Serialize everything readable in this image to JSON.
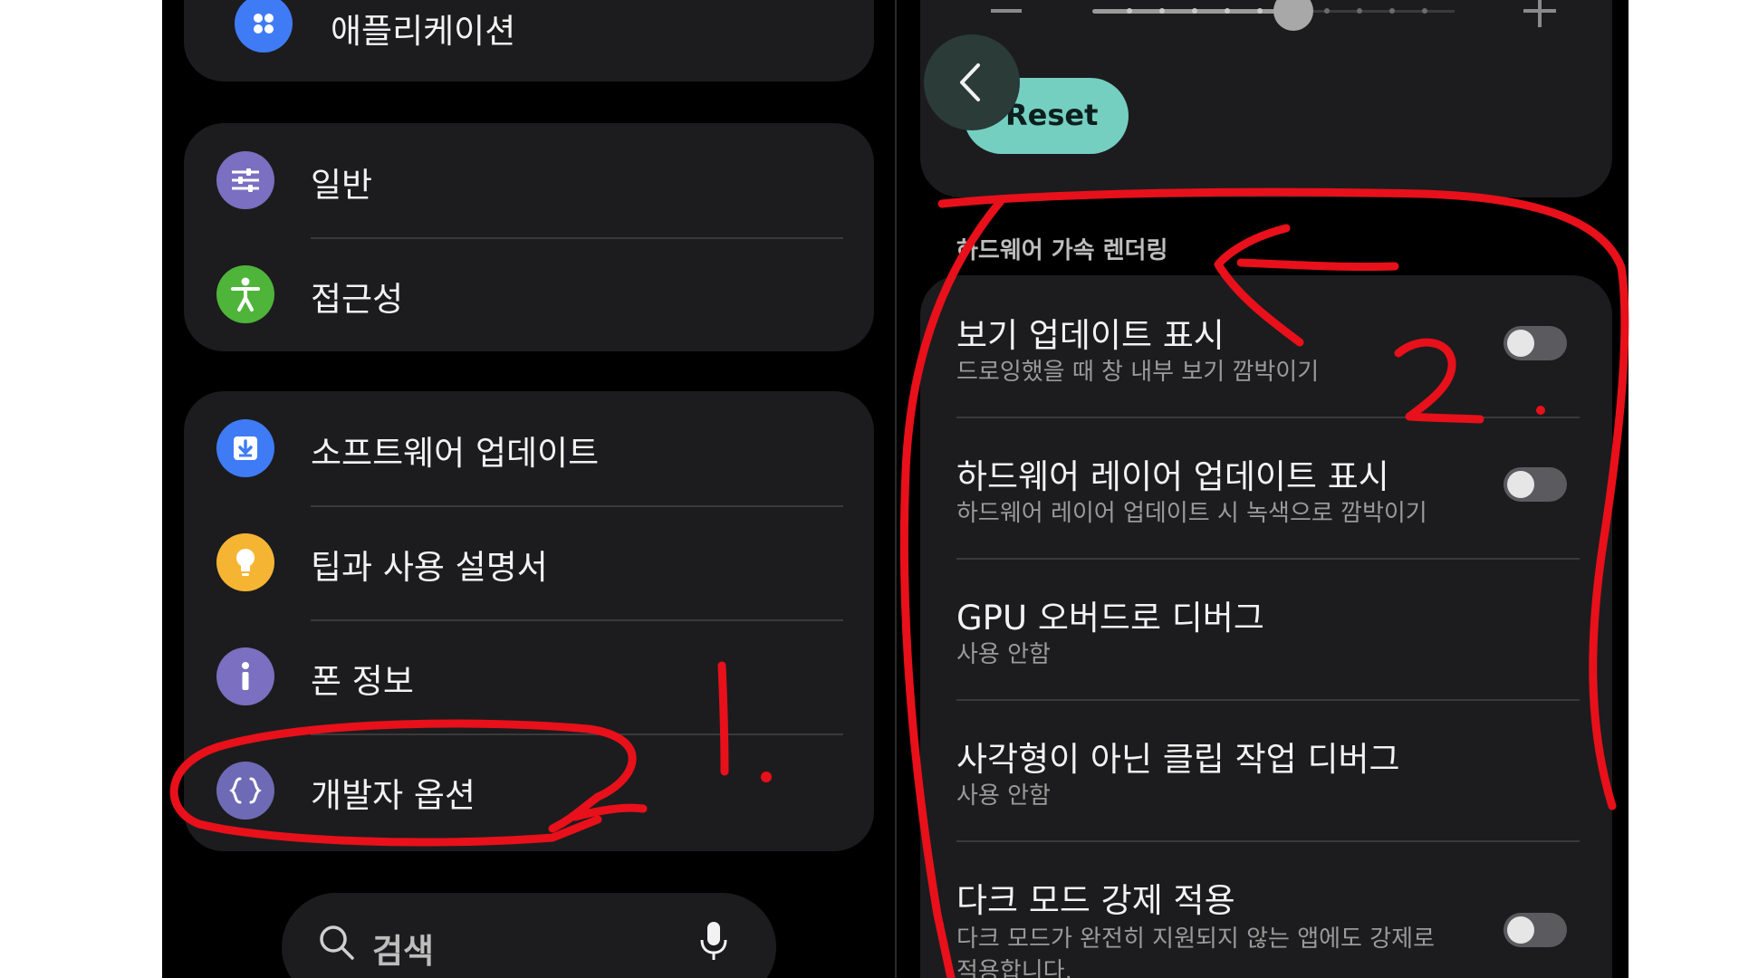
{
  "left_menu": {
    "apps_label": "애플리케이션",
    "general_label": "일반",
    "accessibility_label": "접근성",
    "software_update_label": "소프트웨어 업데이트",
    "tips_label": "팁과 사용 설명서",
    "phone_info_label": "폰 정보",
    "developer_options_label": "개발자 옵션"
  },
  "search": {
    "placeholder": "검색"
  },
  "right_panel": {
    "reset_label": "Reset",
    "section_header": "하드웨어 가속 렌더링",
    "items": [
      {
        "title": "보기 업데이트 표시",
        "subtitle": "드로잉했을 때 창 내부 보기 깜박이기",
        "toggle": "off"
      },
      {
        "title": "하드웨어 레이어 업데이트 표시",
        "subtitle": "하드웨어 레이어 업데이트 시 녹색으로 깜박이기",
        "toggle": "off"
      },
      {
        "title": "GPU 오버드로 디버그",
        "subtitle": "사용 안함"
      },
      {
        "title": "사각형이 아닌 클립 작업 디버그",
        "subtitle": "사용 안함"
      },
      {
        "title": "다크 모드 강제 적용",
        "subtitle": "다크 모드가 완전히 지원되지 않는 앱에도 강제로",
        "subtitle_line2": "적용합니다.",
        "toggle": "off"
      }
    ],
    "slider_value_fraction": 0.55
  },
  "annotations": {
    "step1": "1.",
    "step2": "2."
  },
  "colors": {
    "apps_icon": "#3f7bf5",
    "general_icon": "#7a6fc0",
    "accessibility_icon": "#4fb43a",
    "software_update_icon": "#3f7bf5",
    "tips_icon": "#f5b533",
    "phone_info_icon": "#7a6fc0",
    "developer_icon": "#6f6ab5",
    "reset_button": "#74cfc1",
    "annotation_red": "#e8101a"
  }
}
